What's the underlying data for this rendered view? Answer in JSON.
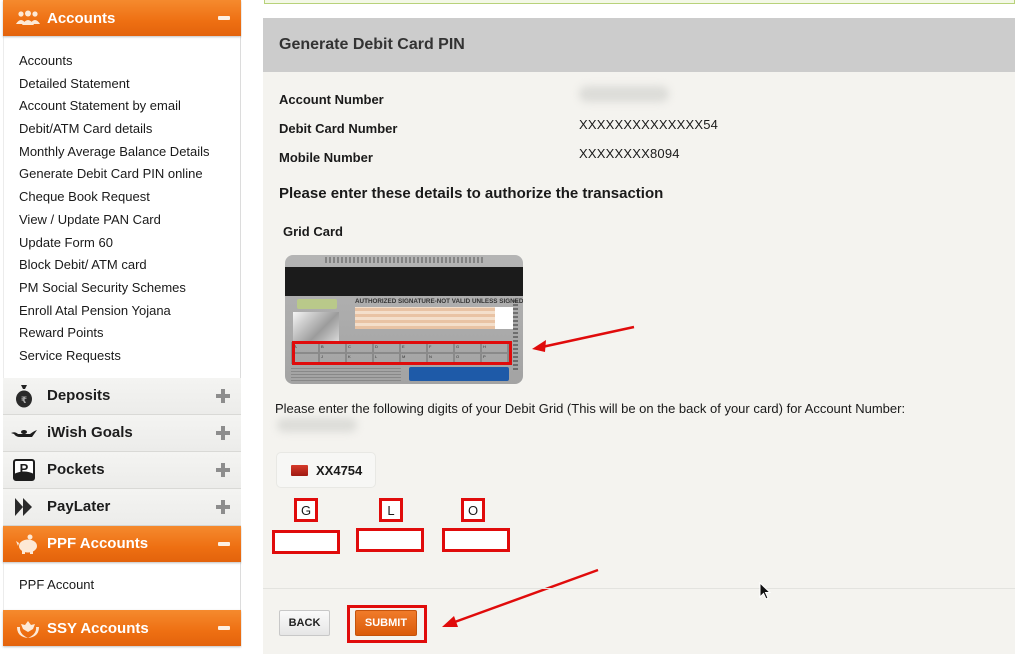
{
  "sidebar": {
    "accounts": {
      "title": "Accounts",
      "icon": "users-icon",
      "items": [
        {
          "label": "Accounts"
        },
        {
          "label": "Detailed Statement"
        },
        {
          "label": "Account Statement by email"
        },
        {
          "label": "Debit/ATM Card details"
        },
        {
          "label": "Monthly Average Balance Details"
        },
        {
          "label": "Generate Debit Card PIN online"
        },
        {
          "label": "Cheque Book Request"
        },
        {
          "label": "View / Update PAN Card"
        },
        {
          "label": "Update Form 60"
        },
        {
          "label": "Block Debit/ ATM card"
        },
        {
          "label": "PM Social Security Schemes"
        },
        {
          "label": "Enroll Atal Pension Yojana"
        },
        {
          "label": "Reward Points"
        },
        {
          "label": "Service Requests"
        }
      ]
    },
    "collapsed": [
      {
        "label": "Deposits",
        "icon": "money-bag-icon"
      },
      {
        "label": "iWish Goals",
        "icon": "magic-lamp-icon"
      },
      {
        "label": "Pockets",
        "icon": "pockets-icon"
      },
      {
        "label": "PayLater",
        "icon": "double-chevron-icon"
      }
    ],
    "ppf": {
      "title": "PPF Accounts",
      "icon": "piggy-bank-icon",
      "items": [
        {
          "label": "PPF Account"
        }
      ]
    },
    "ssy": {
      "title": "SSY Accounts",
      "icon": "hands-care-icon"
    }
  },
  "main": {
    "title": "Generate Debit Card PIN",
    "fields": {
      "account_number_label": "Account Number",
      "debit_card_label": "Debit Card Number",
      "debit_card_value": "XXXXXXXXXXXXXX54",
      "mobile_label": "Mobile Number",
      "mobile_value": "XXXXXXXX8094"
    },
    "auth_heading": "Please enter these details to authorize the transaction",
    "grid_card_label": "Grid Card",
    "card": {
      "signature_text": "AUTHORIZED SIGNATURE-NOT VALID UNLESS SIGNED",
      "grid_letters": [
        "A",
        "B",
        "C",
        "D",
        "E",
        "F",
        "G",
        "H",
        "I",
        "J",
        "K",
        "L",
        "M",
        "N",
        "O",
        "P"
      ]
    },
    "instruction": "Please enter the following digits of your Debit Grid (This will be on the back of your card) for Account Number:",
    "account_chip": "XX4754",
    "grid_inputs": [
      {
        "letter": "G",
        "value": ""
      },
      {
        "letter": "L",
        "value": ""
      },
      {
        "letter": "O",
        "value": ""
      }
    ],
    "buttons": {
      "back": "BACK",
      "submit": "SUBMIT"
    }
  },
  "colors": {
    "accent_orange": "#ee6f12",
    "highlight_red": "#e00b0b",
    "panel_header": "#cccccc",
    "panel_bg": "#f4f3ef"
  }
}
